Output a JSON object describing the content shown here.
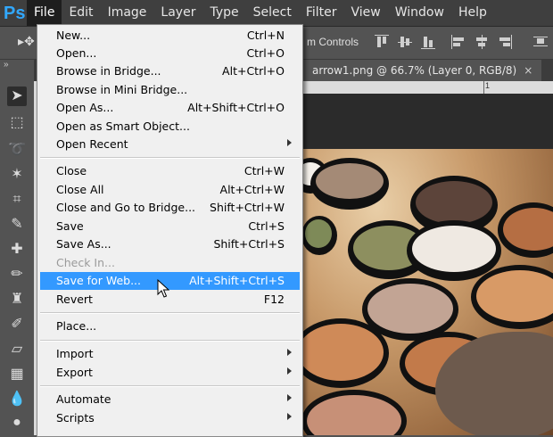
{
  "app": {
    "logo": "Ps"
  },
  "menubar": {
    "items": [
      "File",
      "Edit",
      "Image",
      "Layer",
      "Type",
      "Select",
      "Filter",
      "View",
      "Window",
      "Help"
    ],
    "active": "File"
  },
  "options_bar": {
    "controls_label": "m Controls"
  },
  "document_tab": {
    "title": "arrow1.png @ 66.7% (Layer 0, RGB/8)",
    "close_symbol": "×"
  },
  "ruler": {
    "tick_label": "1"
  },
  "file_menu": {
    "items": [
      {
        "label": "New...",
        "shortcut": "Ctrl+N"
      },
      {
        "label": "Open...",
        "shortcut": "Ctrl+O"
      },
      {
        "label": "Browse in Bridge...",
        "shortcut": "Alt+Ctrl+O"
      },
      {
        "label": "Browse in Mini Bridge...",
        "shortcut": ""
      },
      {
        "label": "Open As...",
        "shortcut": "Alt+Shift+Ctrl+O"
      },
      {
        "label": "Open as Smart Object...",
        "shortcut": ""
      },
      {
        "label": "Open Recent",
        "shortcut": "",
        "submenu": true
      },
      {
        "label": "Close",
        "shortcut": "Ctrl+W"
      },
      {
        "label": "Close All",
        "shortcut": "Alt+Ctrl+W"
      },
      {
        "label": "Close and Go to Bridge...",
        "shortcut": "Shift+Ctrl+W"
      },
      {
        "label": "Save",
        "shortcut": "Ctrl+S"
      },
      {
        "label": "Save As...",
        "shortcut": "Shift+Ctrl+S"
      },
      {
        "label": "Check In...",
        "shortcut": "",
        "disabled": true
      },
      {
        "label": "Save for Web...",
        "shortcut": "Alt+Shift+Ctrl+S",
        "highlighted": true
      },
      {
        "label": "Revert",
        "shortcut": "F12"
      },
      {
        "label": "Place...",
        "shortcut": ""
      },
      {
        "label": "Import",
        "shortcut": "",
        "submenu": true
      },
      {
        "label": "Export",
        "shortcut": "",
        "submenu": true
      },
      {
        "label": "Automate",
        "shortcut": "",
        "submenu": true
      },
      {
        "label": "Scripts",
        "shortcut": "",
        "submenu": true
      }
    ]
  },
  "colors": {
    "highlight": "#3399ff",
    "menubar": "#3f3f3f",
    "panel": "#535353",
    "menu_bg": "#f0f0f0"
  }
}
